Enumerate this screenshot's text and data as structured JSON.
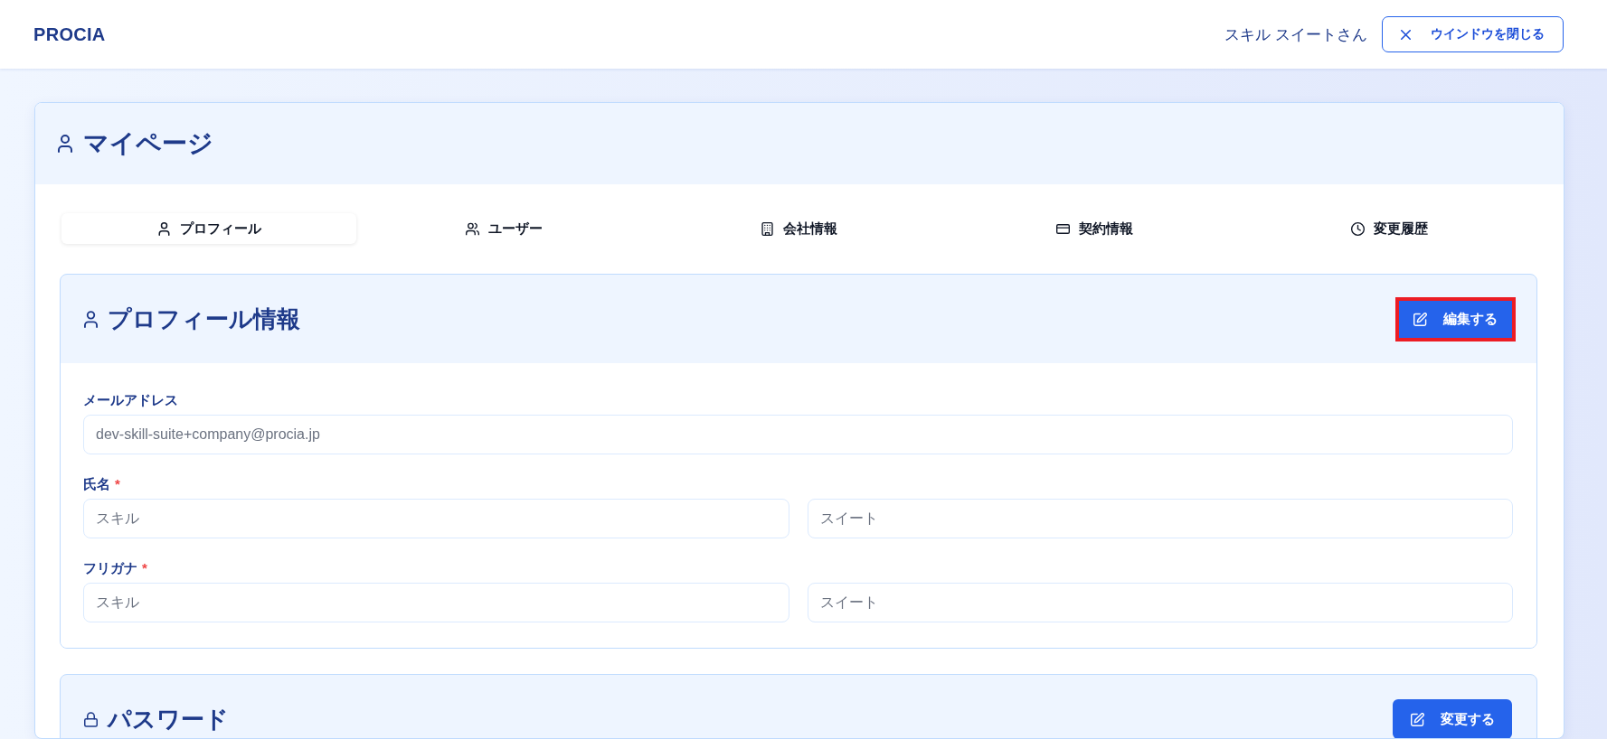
{
  "header": {
    "logo": "PROCIA",
    "user_name": "スキル スイートさん",
    "close_button": "ウインドウを閉じる"
  },
  "page": {
    "title": "マイページ"
  },
  "tabs": [
    {
      "kind": "profile",
      "label": "プロフィール",
      "selected": true
    },
    {
      "kind": "users",
      "label": "ユーザー",
      "selected": false
    },
    {
      "kind": "company",
      "label": "会社情報",
      "selected": false
    },
    {
      "kind": "contract",
      "label": "契約情報",
      "selected": false
    },
    {
      "kind": "history",
      "label": "変更履歴",
      "selected": false
    }
  ],
  "sections": [
    {
      "kind": "profile",
      "title": "プロフィール情報",
      "button": {
        "label": "編集する",
        "highlighted": true
      },
      "fields": [
        {
          "label": "メールアドレス",
          "inputs": [
            {
              "value": "dev-skill-suite+company@procia.jp",
              "disabled": true
            }
          ]
        },
        {
          "label": "氏名",
          "required_mark": "*",
          "inputs": [
            {
              "value": "スキル",
              "disabled": true
            },
            {
              "value": "スイート",
              "disabled": true
            }
          ]
        },
        {
          "label": "フリガナ",
          "required_mark": "*",
          "inputs": [
            {
              "value": "スキル",
              "disabled": true
            },
            {
              "value": "スイート",
              "disabled": true
            }
          ]
        }
      ]
    },
    {
      "kind": "password",
      "title": "パスワード",
      "button": {
        "label": "変更する",
        "highlighted": false
      }
    }
  ]
}
